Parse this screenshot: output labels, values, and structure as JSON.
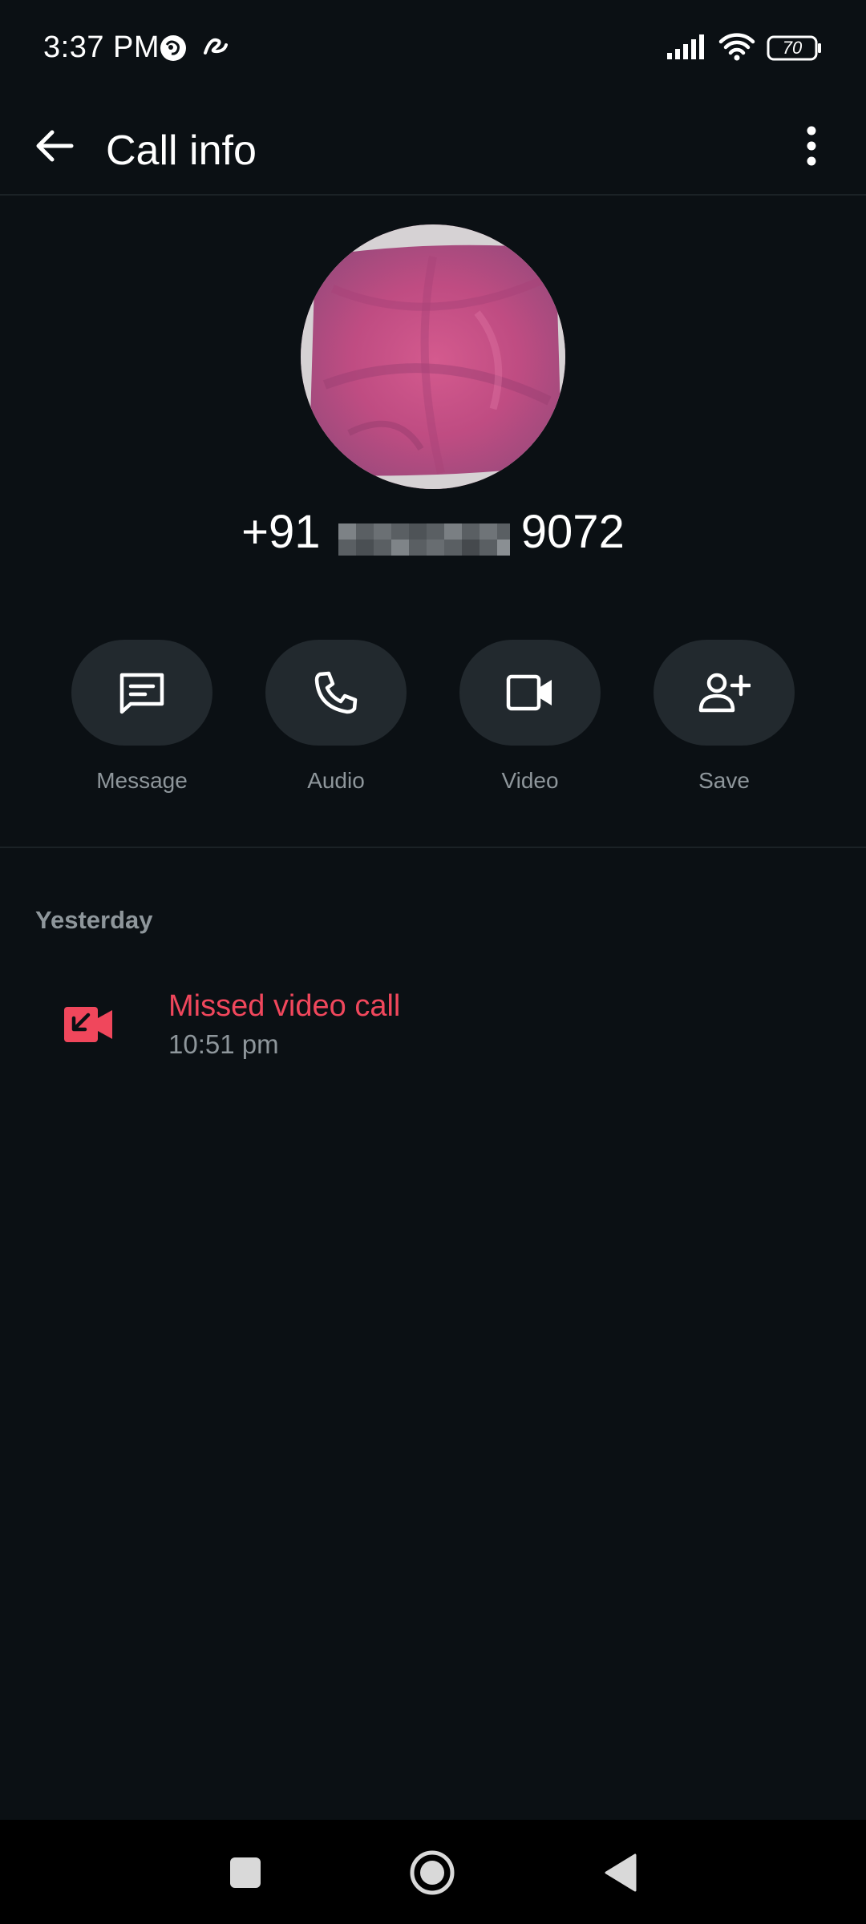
{
  "status_bar": {
    "time": "3:37 PM",
    "battery": "70",
    "icons": [
      "app-notification-icon",
      "app-notification-icon-2",
      "signal-icon",
      "wifi-icon",
      "battery-icon"
    ]
  },
  "app_bar": {
    "title": "Call info",
    "back_icon": "arrow-back-icon",
    "menu_icon": "more-vert-icon"
  },
  "contact": {
    "number_prefix": "+91",
    "number_suffix": "9072"
  },
  "actions": [
    {
      "label": "Message",
      "icon": "message-icon"
    },
    {
      "label": "Audio",
      "icon": "phone-icon"
    },
    {
      "label": "Video",
      "icon": "videocam-icon"
    },
    {
      "label": "Save",
      "icon": "person-add-icon"
    }
  ],
  "history": {
    "section": "Yesterday",
    "calls": [
      {
        "title": "Missed video call",
        "time": "10:51 pm",
        "icon": "missed-video-call-icon"
      }
    ]
  },
  "colors": {
    "background": "#0b1014",
    "pill": "#22292e",
    "missed": "#f0475c",
    "secondary_text": "#8e969b"
  }
}
